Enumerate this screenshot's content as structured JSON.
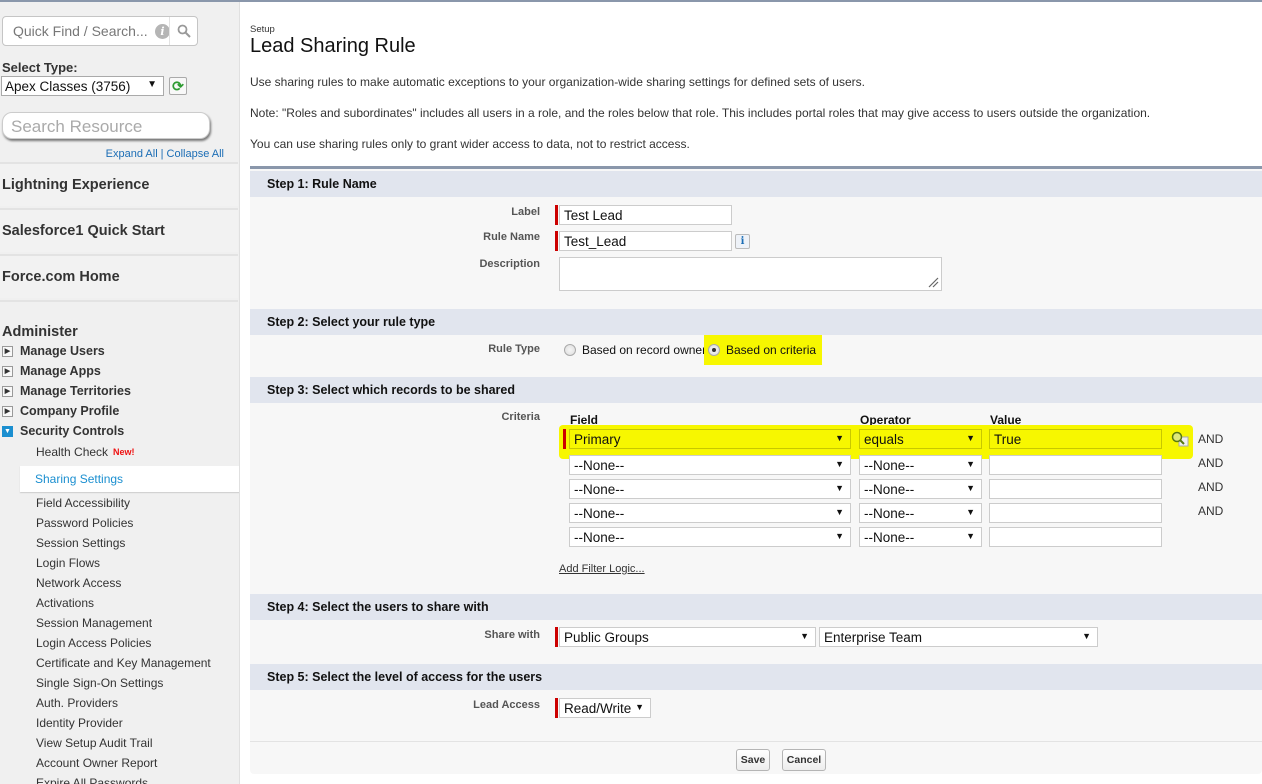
{
  "sidebar": {
    "quick_find_placeholder": "Quick Find / Search...",
    "select_type_label": "Select Type:",
    "select_type_value": "Apex Classes (3756)",
    "search_resource_placeholder": "Search Resource",
    "expand_all": "Expand All",
    "collapse_all": "Collapse All",
    "separator": "|",
    "nav_blocks": [
      "Lightning Experience",
      "Salesforce1 Quick Start",
      "Force.com Home"
    ],
    "administer": "Administer",
    "tree": [
      {
        "label": "Manage Users",
        "expanded": false
      },
      {
        "label": "Manage Apps",
        "expanded": false
      },
      {
        "label": "Manage Territories",
        "expanded": false
      },
      {
        "label": "Company Profile",
        "expanded": false
      },
      {
        "label": "Security Controls",
        "expanded": true
      }
    ],
    "security_items": [
      {
        "label": "Health Check",
        "badge": "New!"
      },
      {
        "label": "Sharing Settings",
        "active": true
      },
      {
        "label": "Field Accessibility"
      },
      {
        "label": "Password Policies"
      },
      {
        "label": "Session Settings"
      },
      {
        "label": "Login Flows"
      },
      {
        "label": "Network Access"
      },
      {
        "label": "Activations"
      },
      {
        "label": "Session Management"
      },
      {
        "label": "Login Access Policies"
      },
      {
        "label": "Certificate and Key Management"
      },
      {
        "label": "Single Sign-On Settings"
      },
      {
        "label": "Auth. Providers"
      },
      {
        "label": "Identity Provider"
      },
      {
        "label": "View Setup Audit Trail"
      },
      {
        "label": "Account Owner Report"
      },
      {
        "label": "Expire All Passwords"
      }
    ]
  },
  "header": {
    "breadcrumb": "Setup",
    "title": "Lead Sharing Rule",
    "paragraphs": [
      "Use sharing rules to make automatic exceptions to your organization-wide sharing settings for defined sets of users.",
      "Note: \"Roles and subordinates\" includes all users in a role, and the roles below that role. This includes portal roles that may give access to users outside the organization.",
      "You can use sharing rules only to grant wider access to data, not to restrict access."
    ]
  },
  "step1": {
    "heading": "Step 1: Rule Name",
    "label_label": "Label",
    "label_value": "Test Lead",
    "rule_name_label": "Rule Name",
    "rule_name_value": "Test_Lead",
    "description_label": "Description",
    "description_value": ""
  },
  "step2": {
    "heading": "Step 2: Select your rule type",
    "rule_type_label": "Rule Type",
    "options": [
      "Based on record owner",
      "Based on criteria"
    ],
    "selected": "Based on criteria"
  },
  "step3": {
    "heading": "Step 3: Select which records to be shared",
    "criteria_label": "Criteria",
    "columns": [
      "Field",
      "Operator",
      "Value"
    ],
    "rows": [
      {
        "field": "Primary",
        "operator": "equals",
        "value": "True",
        "conj": "AND"
      },
      {
        "field": "--None--",
        "operator": "--None--",
        "value": "",
        "conj": "AND"
      },
      {
        "field": "--None--",
        "operator": "--None--",
        "value": "",
        "conj": "AND"
      },
      {
        "field": "--None--",
        "operator": "--None--",
        "value": "",
        "conj": "AND"
      },
      {
        "field": "--None--",
        "operator": "--None--",
        "value": "",
        "conj": ""
      }
    ],
    "add_filter_logic": "Add Filter Logic..."
  },
  "step4": {
    "heading": "Step 4: Select the users to share with",
    "share_with_label": "Share with",
    "share_with_type": "Public Groups",
    "share_with_value": "Enterprise Team"
  },
  "step5": {
    "heading": "Step 5: Select the level of access for the users",
    "lead_access_label": "Lead Access",
    "lead_access_value": "Read/Write"
  },
  "buttons": {
    "save": "Save",
    "cancel": "Cancel"
  },
  "colors": {
    "highlight": "#f7f700",
    "required": "#cc0000",
    "link": "#1b8fd0",
    "step_header": "#e1e5ee"
  }
}
